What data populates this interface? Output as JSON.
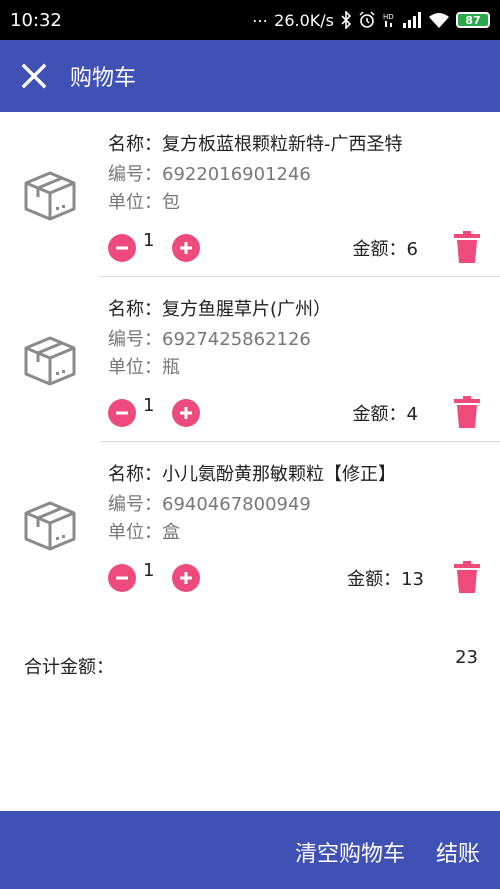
{
  "status_bar": {
    "time": "10:32",
    "network_speed": "26.0K/s",
    "battery": "87",
    "icons": [
      "bluetooth-icon",
      "alarm-icon",
      "hd-icon",
      "signal-icon",
      "wifi-icon",
      "battery-icon"
    ]
  },
  "app_bar": {
    "title": "购物车",
    "close_icon": "close-icon",
    "color": "#3f51b5"
  },
  "items": [
    {
      "name": "名称：复方板蓝根颗粒新特-广西圣特",
      "code": "编号：6922016901246",
      "unit": "单位：包",
      "quantity": "1",
      "amount": "金额：6"
    },
    {
      "name": "名称：复方鱼腥草片(广州）",
      "code": "编号：6927425862126",
      "unit": "单位：瓶",
      "quantity": "1",
      "amount": "金额：4"
    },
    {
      "name": "名称：小儿氨酚黄那敏颗粒【修正】",
      "code": "编号：6940467800949",
      "unit": "单位：盒",
      "quantity": "1",
      "amount": "金额：13"
    }
  ],
  "total": {
    "label": "合计金额：",
    "value": "23"
  },
  "bottom_bar": {
    "clear_label": "清空购物车",
    "checkout_label": "结账"
  },
  "colors": {
    "primary": "#3f51b5",
    "accent": "#ee4b7c",
    "icon_gray": "#8a8a8a"
  }
}
